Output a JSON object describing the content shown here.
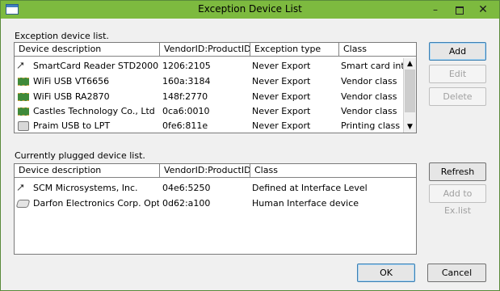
{
  "window": {
    "title": "Exception Device List",
    "minimize_glyph": "–",
    "close_glyph": "✕"
  },
  "exception_section": {
    "label": "Exception device list.",
    "columns": [
      "Device description",
      "VendorID:ProductID",
      "Exception type",
      "Class"
    ],
    "rows": [
      {
        "icon": "usb-icon",
        "description": "SmartCard Reader STD2000",
        "vid_pid": "1206:2105",
        "exception_type": "Never Export",
        "class": "Smart card inter"
      },
      {
        "icon": "network-chip-icon",
        "description": "WiFi USB VT6656",
        "vid_pid": "160a:3184",
        "exception_type": "Never Export",
        "class": "Vendor class"
      },
      {
        "icon": "network-chip-icon",
        "description": "WiFi USB RA2870",
        "vid_pid": "148f:2770",
        "exception_type": "Never Export",
        "class": "Vendor class"
      },
      {
        "icon": "network-chip-icon",
        "description": "Castles Technology Co., Ltd",
        "vid_pid": "0ca6:0010",
        "exception_type": "Never Export",
        "class": "Vendor class"
      },
      {
        "icon": "printer-icon",
        "description": "Praim USB to LPT",
        "vid_pid": "0fe6:811e",
        "exception_type": "Never Export",
        "class": "Printing class"
      }
    ],
    "scroll_up": "▲",
    "scroll_down": "▼"
  },
  "plugged_section": {
    "label": "Currently plugged device list.",
    "columns": [
      "Device description",
      "VendorID:ProductID",
      "Class"
    ],
    "rows": [
      {
        "icon": "usb-icon",
        "description": "SCM Microsystems, Inc.",
        "vid_pid": "04e6:5250",
        "class": "Defined at Interface Level"
      },
      {
        "icon": "keyboard-icon",
        "description": "Darfon Electronics Corp. Optical I",
        "vid_pid": "0d62:a100",
        "class": "Human Interface device"
      }
    ]
  },
  "buttons": {
    "add": "Add",
    "edit": "Edit",
    "delete": "Delete",
    "refresh": "Refresh",
    "add_to_exception": "Add to Ex.list",
    "ok": "OK",
    "cancel": "Cancel"
  }
}
